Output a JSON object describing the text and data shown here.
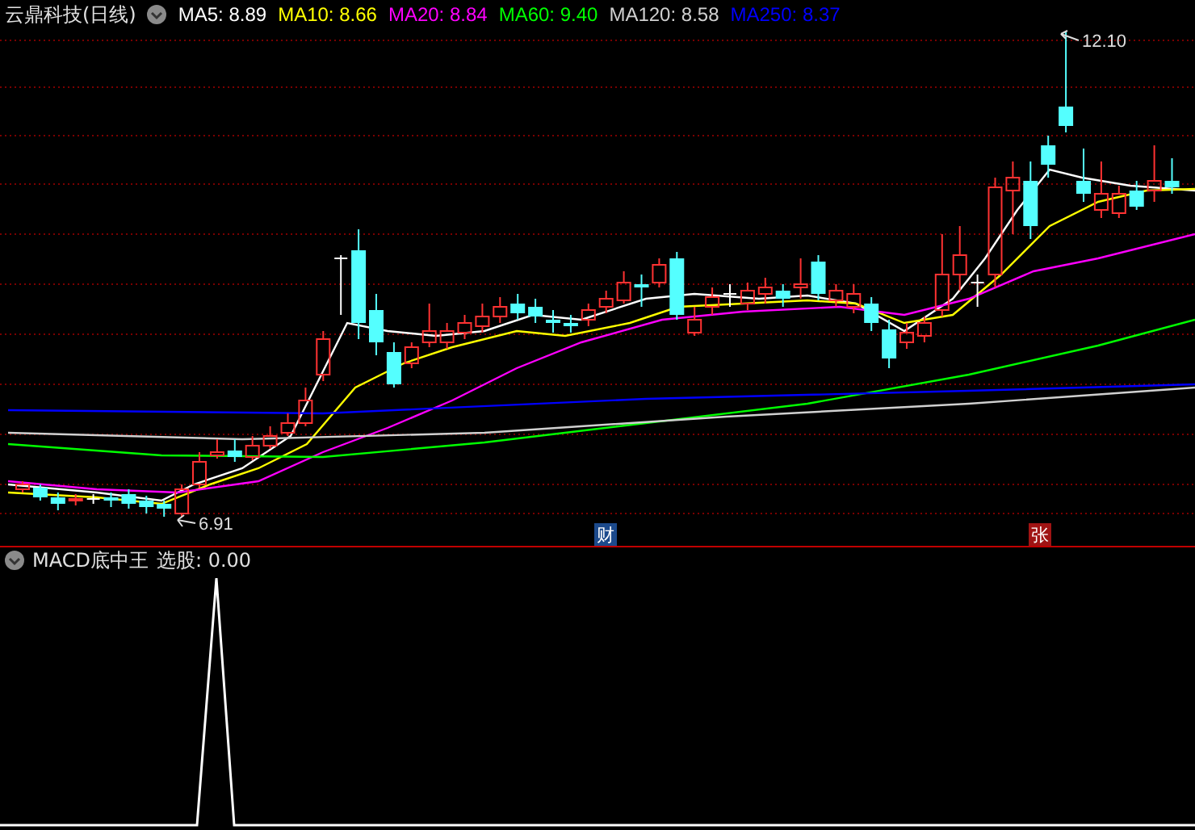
{
  "header": {
    "title": "云鼎科技(日线)",
    "indicators": [
      {
        "label": "MA5: 8.89",
        "color": "#ffffff"
      },
      {
        "label": "MA10: 8.66",
        "color": "#ffff00"
      },
      {
        "label": "MA20: 8.84",
        "color": "#ff00ff"
      },
      {
        "label": "MA60: 9.40",
        "color": "#00ff00"
      },
      {
        "label": "MA120: 8.58",
        "color": "#d0d0d0"
      },
      {
        "label": "MA250: 8.37",
        "color": "#0000ff"
      }
    ]
  },
  "chart": {
    "high_label": "12.10",
    "low_label": "6.91",
    "events": [
      {
        "label": "财",
        "color": "#1c4a8c"
      },
      {
        "label": "张",
        "color": "#a01414"
      }
    ]
  },
  "sub_panel": {
    "name": "MACD底中王",
    "reading": "选股: 0.00"
  }
}
